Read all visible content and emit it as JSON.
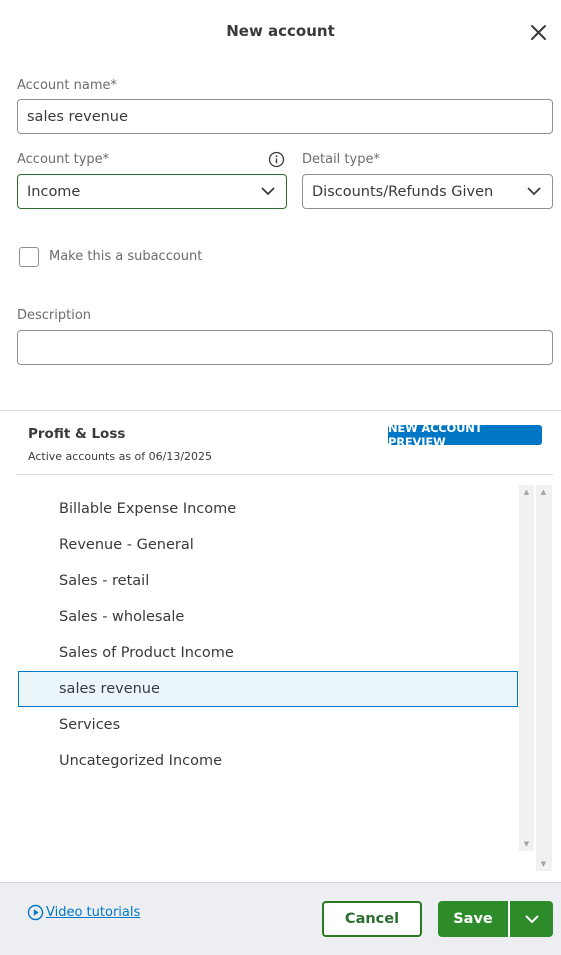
{
  "dialog": {
    "title": "New account"
  },
  "form": {
    "account_name_label": "Account name*",
    "account_name_value": "sales revenue",
    "account_type_label": "Account type*",
    "account_type_value": "Income",
    "detail_type_label": "Detail type*",
    "detail_type_value": "Discounts/Refunds Given",
    "subaccount_label": "Make this a subaccount",
    "subaccount_checked": false,
    "description_label": "Description",
    "description_value": ""
  },
  "preview": {
    "title": "Profit & Loss",
    "subtitle": "Active accounts as of 06/13/2025",
    "badge": "NEW ACCOUNT PREVIEW",
    "items": [
      {
        "label": "Billable Expense Income"
      },
      {
        "label": "Revenue - General"
      },
      {
        "label": "Sales - retail"
      },
      {
        "label": "Sales - wholesale"
      },
      {
        "label": "Sales of Product Income"
      },
      {
        "label": "sales revenue"
      },
      {
        "label": "Services"
      },
      {
        "label": "Uncategorized Income"
      }
    ],
    "selected_item": "sales revenue"
  },
  "footer": {
    "video_tutorials": "Video tutorials",
    "cancel": "Cancel",
    "save": "Save"
  },
  "colors": {
    "accent_green": "#2e8b2a",
    "badge_blue": "#0077c5",
    "selected_bg": "#ebf6fb"
  }
}
